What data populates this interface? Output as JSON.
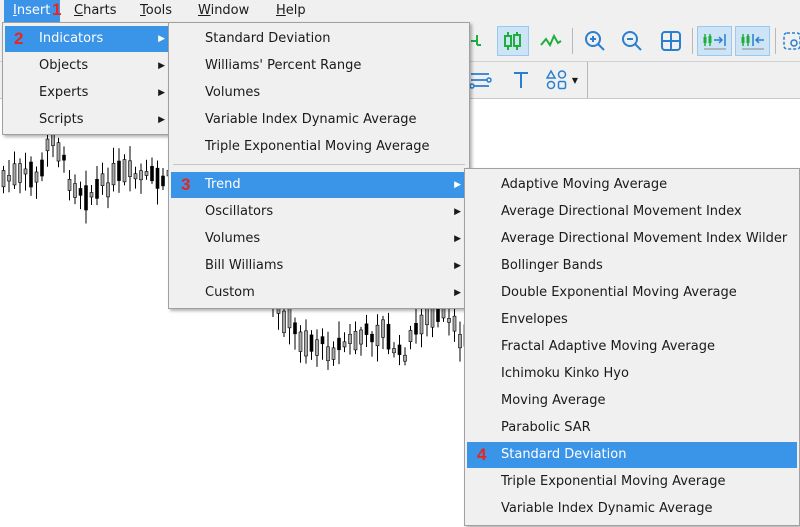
{
  "menubar": {
    "items": [
      {
        "label": "Insert",
        "mnemonic": "I",
        "rest": "nsert",
        "badge": "1"
      },
      {
        "label": "Charts",
        "mnemonic": "C",
        "rest": "harts"
      },
      {
        "label": "Tools",
        "mnemonic": "T",
        "rest": "ools"
      },
      {
        "label": "Window",
        "mnemonic": "W",
        "rest": "indow"
      },
      {
        "label": "Help",
        "mnemonic": "H",
        "rest": "elp"
      }
    ]
  },
  "toolbar": {
    "row1": [
      "line-chart-partial-icon",
      "candlestick-chart-icon",
      "line-chart-icon",
      "zoom-in-icon",
      "zoom-out-icon",
      "tile-windows-icon",
      "chart-shift-icon",
      "autoscroll-icon",
      "screenshot-icon"
    ],
    "row2": [
      "fibonacci-lines-icon",
      "text-tool-icon",
      "shapes-icon",
      "dropdown-arrow-icon"
    ]
  },
  "insert_menu": {
    "items": [
      {
        "label": "Indicators",
        "badge": "2",
        "has_submenu": true,
        "highlighted": true
      },
      {
        "label": "Objects",
        "has_submenu": true
      },
      {
        "label": "Experts",
        "has_submenu": true
      },
      {
        "label": "Scripts",
        "has_submenu": true
      }
    ]
  },
  "indicators_menu": {
    "recent": [
      "Standard Deviation",
      "Williams' Percent Range",
      "Volumes",
      "Variable Index Dynamic Average",
      "Triple Exponential Moving Average"
    ],
    "categories": [
      {
        "label": "Trend",
        "badge": "3",
        "has_submenu": true,
        "highlighted": true
      },
      {
        "label": "Oscillators",
        "has_submenu": true
      },
      {
        "label": "Volumes",
        "has_submenu": true
      },
      {
        "label": "Bill Williams",
        "has_submenu": true
      },
      {
        "label": "Custom",
        "has_submenu": true
      }
    ]
  },
  "trend_menu": {
    "items": [
      {
        "label": "Adaptive Moving Average"
      },
      {
        "label": "Average Directional Movement Index"
      },
      {
        "label": "Average Directional Movement Index Wilder"
      },
      {
        "label": "Bollinger Bands"
      },
      {
        "label": "Double Exponential Moving Average"
      },
      {
        "label": "Envelopes"
      },
      {
        "label": "Fractal Adaptive Moving Average"
      },
      {
        "label": "Ichimoku Kinko Hyo"
      },
      {
        "label": "Moving Average"
      },
      {
        "label": "Parabolic SAR"
      },
      {
        "label": "Standard Deviation",
        "badge": "4",
        "highlighted": true
      },
      {
        "label": "Triple Exponential Moving Average"
      },
      {
        "label": "Variable Index Dynamic Average"
      }
    ]
  },
  "colors": {
    "highlight": "#3a94e8",
    "badge": "#e8251f",
    "menu_bg": "#f0f0f0",
    "icon_green": "#1fae3a",
    "icon_blue": "#2a7fcf"
  }
}
